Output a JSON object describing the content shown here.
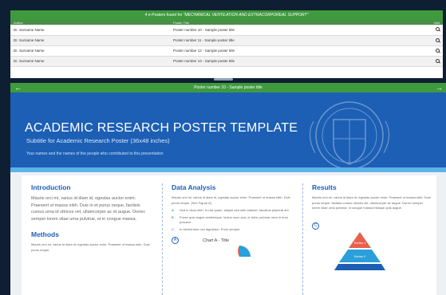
{
  "results": {
    "header_lead": "4 e-Posters found for",
    "header_query": "\"MECHANICAL VENTILATION AND EXTRACORPOREAL SUPPORT\"",
    "columns": {
      "author": "Author",
      "title": "Poster Title",
      "view": "Visit"
    },
    "rows": [
      {
        "author": "Dr. Surname Name",
        "title": "Poster number 10 - Sample poster title"
      },
      {
        "author": "Dr. Surname Name",
        "title": "Poster number 11 - Sample poster title"
      },
      {
        "author": "Dr. Surname Name",
        "title": "Poster number 12 - Sample poster title"
      },
      {
        "author": "Dr. Surname Name",
        "title": "Poster number 13 - Sample poster title"
      }
    ]
  },
  "viewer": {
    "bar_title": "Poster number 10 - Sample poster title",
    "poster": {
      "title": "ACADEMIC RESEARCH POSTER TEMPLATE",
      "subtitle": "Subtitle for Academic Research Poster (36x48 inches)",
      "authors": "Your names and the names of the people who contributed to this presentation",
      "intro_heading": "Introduction",
      "intro_text": "Mauris orci mi, varius id diam id, egestas auctor enim. Praesent ut massa nibh. Duis in et purus neque, facilisis cursus urna id ultrices vel, ullamcorper ac et augue. Donec semper lorem vitae urna pulvinar, et in congue massa.",
      "methods_heading": "Methods",
      "methods_text": "Mauris orci mi, varius id diam id, egestas auctor enim. Praesent ut massa nibh. Duis purus neque,",
      "data_heading": "Data Analysis",
      "data_text": "Mauris orci mi, varius id diam id, egestas auctor enim. Praesent ut massa nibh. Duis purus neque. [See Figure A]",
      "data_items": [
        {
          "letter": "A.",
          "text": "Sed in risus nibh. In nisl quam, aliquet sed nibh sitamet, faucibus placerat dui."
        },
        {
          "letter": "B.",
          "text": "Fusce quis augue scelerisque, luctus nunc sed, ut dolor pulvinar urna in eros posuere."
        },
        {
          "letter": "C.",
          "text": "In elementum orci dignissim. Proin semper."
        }
      ],
      "marker_a": "A",
      "chart_title": "Chart A - Title",
      "results_heading": "Results",
      "results_text": "Mauris orci mi, varius id diam id, egestas auctor enim. Praesent ut massa nibh. Duis purus neque, facilisis cursus ultrices vel, ullamcorper ac augue. Donec semper lorem vitae urna pulvinar, in congue massa tristique quis augue.",
      "marker_c": "C",
      "pyramid": [
        "Series 1",
        "Series 2"
      ]
    }
  },
  "colors": {
    "green_bar": "#3f9a3d",
    "poster_blue": "#1c5fb5",
    "accent_light_blue": "#5db3e8",
    "pyramid_top": "#e8604c",
    "pyramid_mid": "#2b9fd9"
  }
}
